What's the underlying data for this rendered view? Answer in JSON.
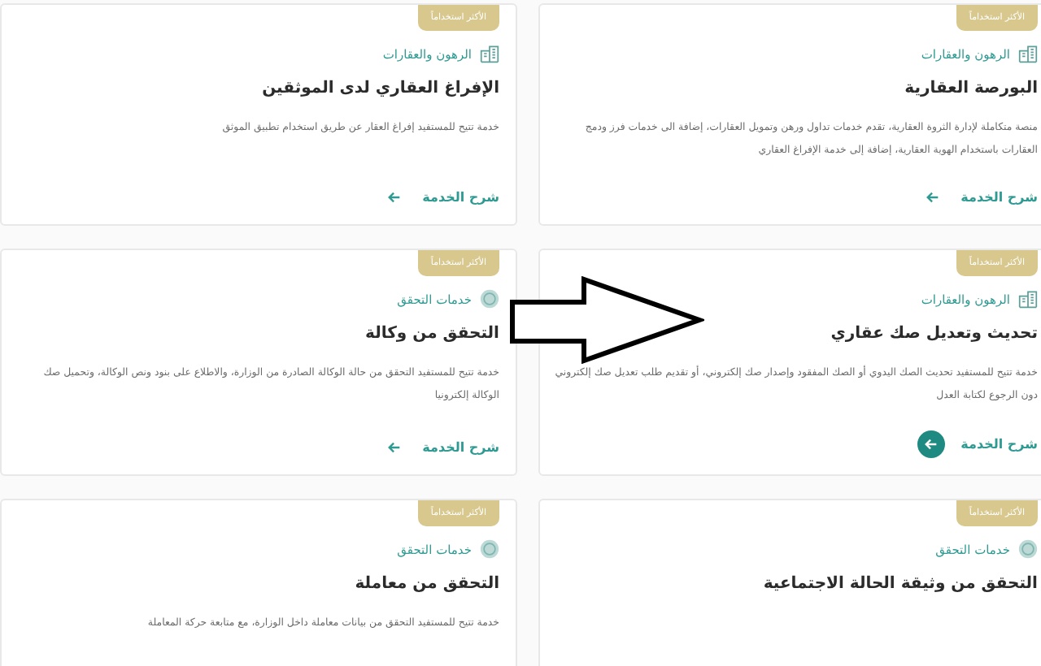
{
  "cards": [
    {
      "badge": "الأكثر استخداماً",
      "category": "الرهون والعقارات",
      "kind": "property",
      "title": "البورصة العقارية",
      "description": "منصة متكاملة لإدارة الثروة العقارية، تقدم خدمات تداول ورهن وتمويل العقارات، إضافة الى خدمات فرز ودمج العقارات باستخدام الهوية العقارية، إضافة إلى خدمة الإفراغ العقاري",
      "link": "شرح الخدمة",
      "active": false
    },
    {
      "badge": "الأكثر استخداماً",
      "category": "الرهون والعقارات",
      "kind": "property",
      "title": "الإفراغ العقاري لدى الموثقين",
      "description": "خدمة تتيح للمستفيد إفراغ العقار عن طريق استخدام تطبيق الموثق",
      "link": "شرح الخدمة",
      "active": false
    },
    {
      "badge": "الأكثر استخداماً",
      "category": "الرهون والعقارات",
      "kind": "property",
      "title": "تحديث وتعديل صك عقاري",
      "description": "خدمة تتيح للمستفيد تحديث الصك اليدوي أو الصك المفقود وإصدار صك إلكتروني، أو تقديم طلب تعديل صك إلكتروني دون الرجوع لكتابة العدل",
      "link": "شرح الخدمة",
      "active": true
    },
    {
      "badge": "الأكثر استخداماً",
      "category": "خدمات التحقق",
      "kind": "verify",
      "title": "التحقق من وكالة",
      "description": "خدمة تتيح للمستفيد التحقق من حالة الوكالة الصادرة من الوزارة، والاطلاع على بنود ونص الوكالة، وتحميل صك الوكالة إلكترونيا",
      "link": "شرح الخدمة",
      "active": false
    },
    {
      "badge": "الأكثر استخداماً",
      "category": "خدمات التحقق",
      "kind": "verify",
      "title": "التحقق من وثيقة الحالة الاجتماعية"
    },
    {
      "badge": "الأكثر استخداماً",
      "category": "خدمات التحقق",
      "kind": "verify",
      "title": "التحقق من معاملة",
      "description": "خدمة تتيح للمستفيد التحقق من بيانات معاملة داخل الوزارة، مع متابعة حركة المعاملة"
    }
  ]
}
